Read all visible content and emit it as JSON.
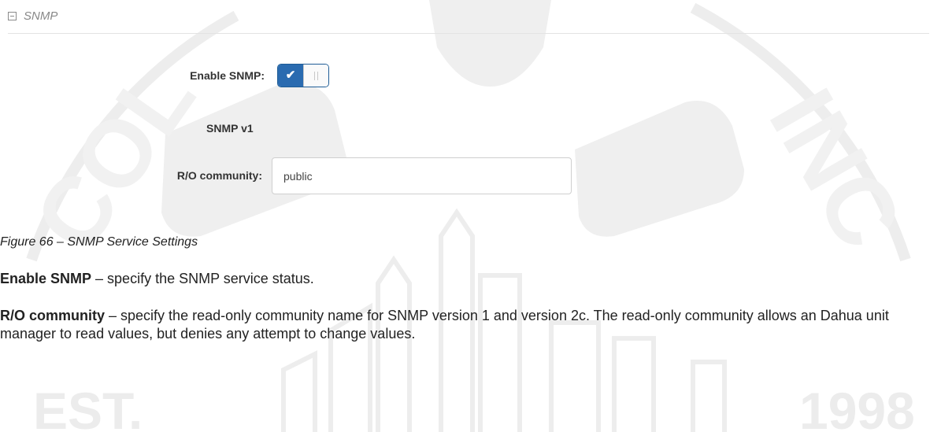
{
  "section": {
    "title": "SNMP",
    "collapse_icon": "minus-square-icon"
  },
  "form": {
    "enable_snmp": {
      "label": "Enable SNMP:",
      "checked": true,
      "check_icon": "checkmark-icon",
      "check_glyph": "✔"
    },
    "snmp_v1_heading": "SNMP v1",
    "ro_community": {
      "label": "R/O community:",
      "value": "public"
    }
  },
  "figure_caption": "Figure 66 – SNMP Service Settings",
  "descriptions": [
    {
      "term": "Enable SNMP",
      "text": " – specify the SNMP service status."
    },
    {
      "term": "R/O community",
      "text": " – specify the read-only community name for SNMP version 1 and version 2c. The read-only community allows an Dahua unit manager to read values, but denies any attempt to change values."
    }
  ],
  "watermark": {
    "left_text": "EST.",
    "right_text": "1998"
  },
  "colors": {
    "toggle_on": "#2a6bb0",
    "section_title": "#888888",
    "watermark": "#ececec"
  }
}
